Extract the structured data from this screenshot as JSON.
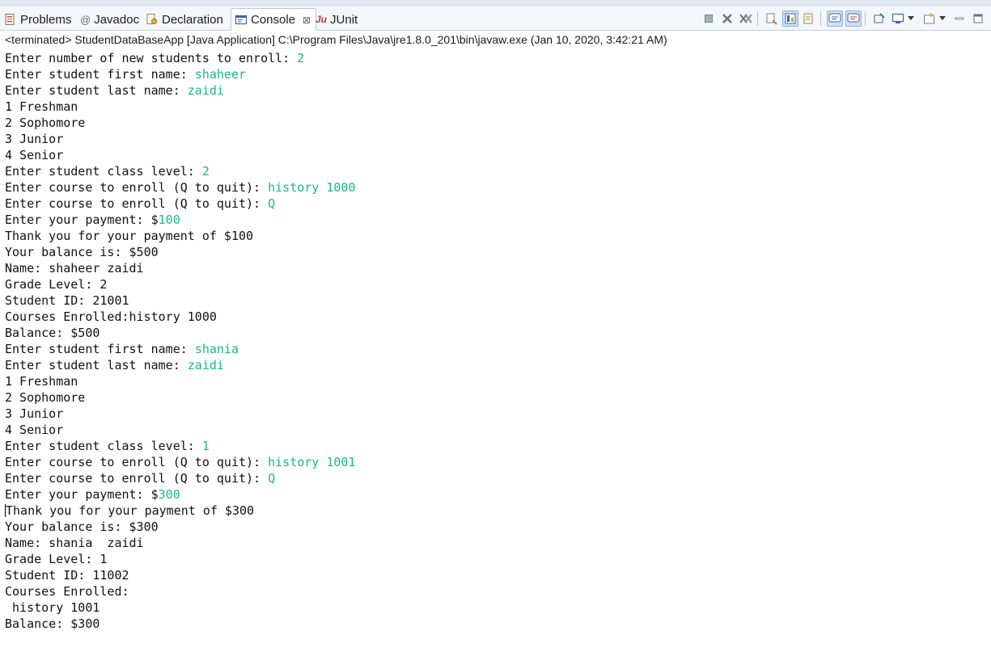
{
  "tabs": [
    {
      "label": "Problems",
      "icon": "problems-icon",
      "active": false
    },
    {
      "label": "Javadoc",
      "icon": "at-icon",
      "active": false
    },
    {
      "label": "Declaration",
      "icon": "declaration-icon",
      "active": false
    },
    {
      "label": "Console",
      "icon": "console-icon",
      "active": true,
      "close": "⊠"
    },
    {
      "label": "JUnit",
      "icon": "junit-icon",
      "active": false
    }
  ],
  "junit_icon_text": "Ju",
  "javadoc_icon_text": "@",
  "status": "<terminated> StudentDataBaseApp [Java Application] C:\\Program Files\\Java\\jre1.8.0_201\\bin\\javaw.exe (Jan 10, 2020, 3:42:21 AM)",
  "colors": {
    "user_input": "#19b88a",
    "output_text": "#111111",
    "tab_bar": "#f3f6fa"
  },
  "console_lines": [
    {
      "out": "Enter number of new students to enroll: ",
      "in": "2"
    },
    {
      "out": "Enter student first name: ",
      "in": "shaheer"
    },
    {
      "out": "Enter student last name: ",
      "in": "zaidi"
    },
    {
      "out": "1 Freshman",
      "in": ""
    },
    {
      "out": "2 Sophomore",
      "in": ""
    },
    {
      "out": "3 Junior",
      "in": ""
    },
    {
      "out": "4 Senior",
      "in": ""
    },
    {
      "out": "Enter student class level: ",
      "in": "2"
    },
    {
      "out": "Enter course to enroll (Q to quit): ",
      "in": "history 1000"
    },
    {
      "out": "Enter course to enroll (Q to quit): ",
      "in": "Q"
    },
    {
      "out": "Enter your payment: $",
      "in": "100"
    },
    {
      "out": "Thank you for your payment of $100",
      "in": ""
    },
    {
      "out": "Your balance is: $500",
      "in": ""
    },
    {
      "out": "Name: shaheer zaidi",
      "in": ""
    },
    {
      "out": "Grade Level: 2",
      "in": ""
    },
    {
      "out": "Student ID: 21001",
      "in": ""
    },
    {
      "out": "Courses Enrolled:history 1000",
      "in": ""
    },
    {
      "out": "Balance: $500",
      "in": ""
    },
    {
      "out": "Enter student first name: ",
      "in": "shania"
    },
    {
      "out": "Enter student last name: ",
      "in": "zaidi"
    },
    {
      "out": "1 Freshman",
      "in": ""
    },
    {
      "out": "2 Sophomore",
      "in": ""
    },
    {
      "out": "3 Junior",
      "in": ""
    },
    {
      "out": "4 Senior",
      "in": ""
    },
    {
      "out": "Enter student class level: ",
      "in": "1"
    },
    {
      "out": "Enter course to enroll (Q to quit): ",
      "in": "history 1001"
    },
    {
      "out": "Enter course to enroll (Q to quit): ",
      "in": "Q"
    },
    {
      "out": "Enter your payment: $",
      "in": "300"
    },
    {
      "out": "Thank you for your payment of $300",
      "in": "",
      "caret": true
    },
    {
      "out": "Your balance is: $300",
      "in": ""
    },
    {
      "out": "Name: shania  zaidi",
      "in": ""
    },
    {
      "out": "Grade Level: 1",
      "in": ""
    },
    {
      "out": "Student ID: 11002",
      "in": ""
    },
    {
      "out": "Courses Enrolled:",
      "in": ""
    },
    {
      "out": " history 1001",
      "in": ""
    },
    {
      "out": "Balance: $300",
      "in": ""
    }
  ],
  "toolbar_icons": [
    "terminate-icon",
    "remove-launch-icon",
    "remove-all-terminated-icon",
    "clear-console-icon",
    "scroll-lock-icon",
    "word-wrap-icon",
    "show-on-stdout-icon",
    "show-on-stderr-icon",
    "pin-console-icon",
    "display-selected-console-icon",
    "open-console-icon",
    "minimize-icon",
    "maximize-icon"
  ]
}
